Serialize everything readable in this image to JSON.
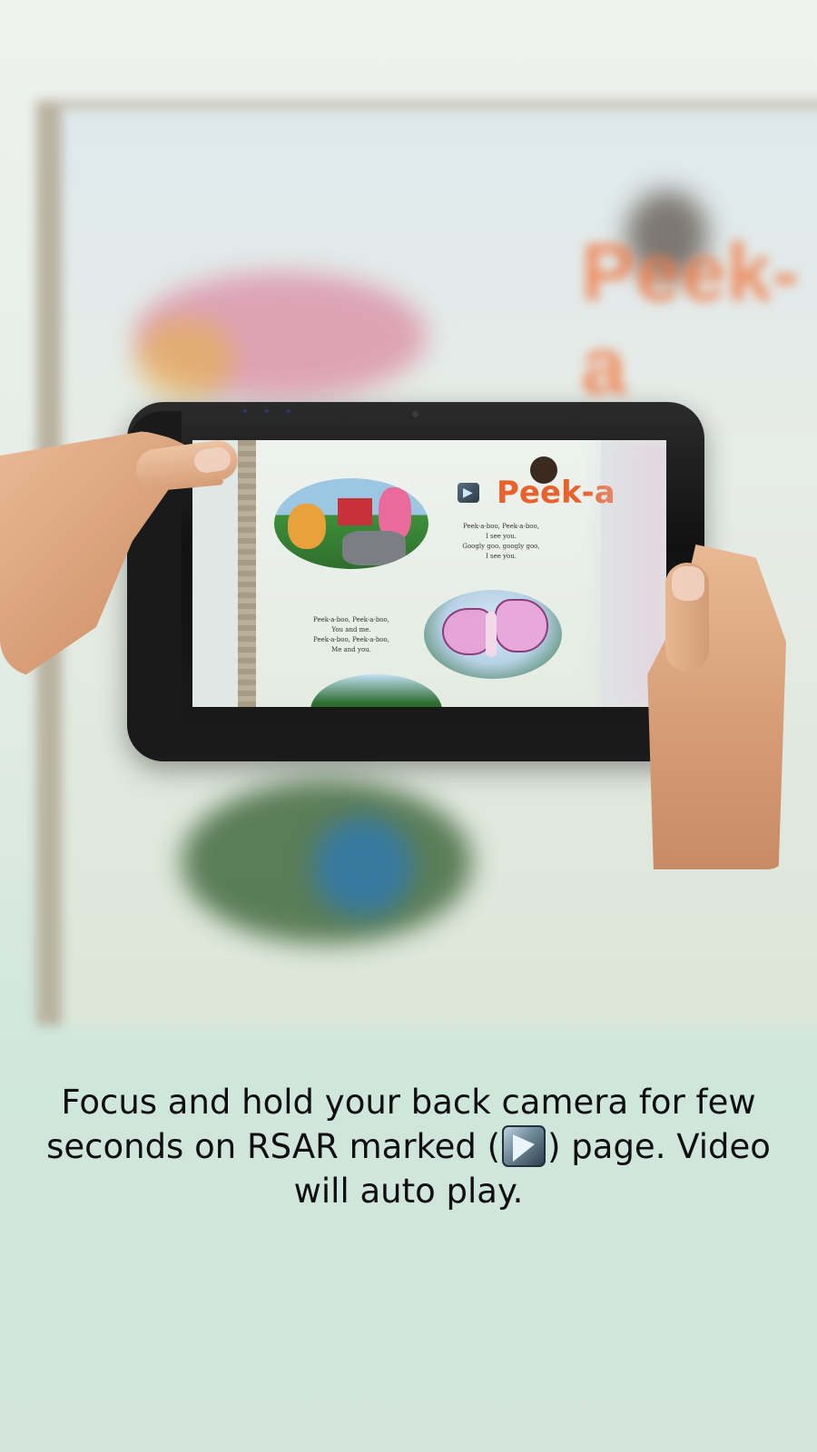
{
  "book": {
    "title": "Peek-a",
    "verse_top": [
      "Peek-a-boo, Peek-a-boo,",
      "I see you.",
      "Googly goo, googly goo,",
      "I see you."
    ],
    "verse_bottom": [
      "Peek-a-boo, Peek-a-boo,",
      "You and me.",
      "Peek-a-boo, Peek-a-boo,",
      "Me and you."
    ]
  },
  "instruction": {
    "before_marker": "Focus and hold your back camera for few seconds on RSAR marked (",
    "after_marker": ") page. Video will auto play."
  },
  "icons": {
    "marker": "rsar-marker-icon"
  }
}
